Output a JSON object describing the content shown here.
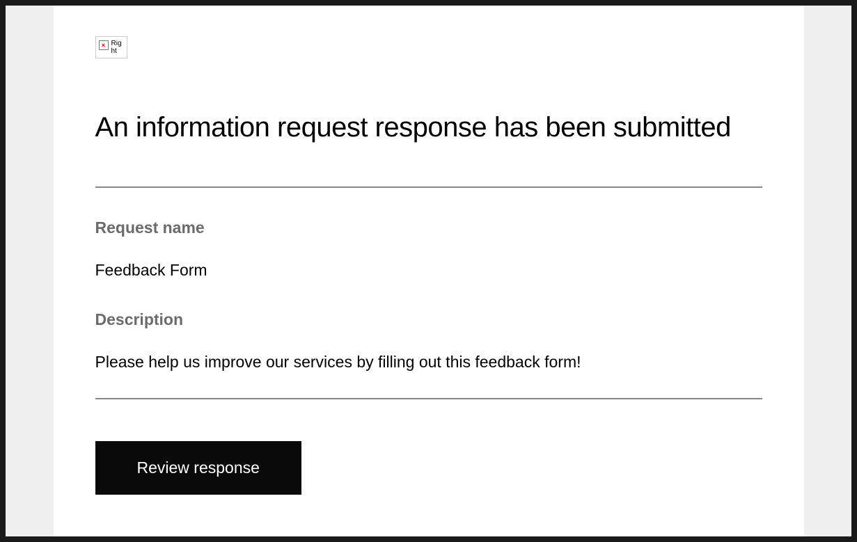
{
  "brokenImage": {
    "altText": "Right"
  },
  "heading": "An information request response has been submitted",
  "fields": {
    "requestName": {
      "label": "Request name",
      "value": "Feedback Form"
    },
    "description": {
      "label": "Description",
      "value": "Please help us improve our services by filling out this feedback form!"
    }
  },
  "cta": {
    "label": "Review response"
  }
}
